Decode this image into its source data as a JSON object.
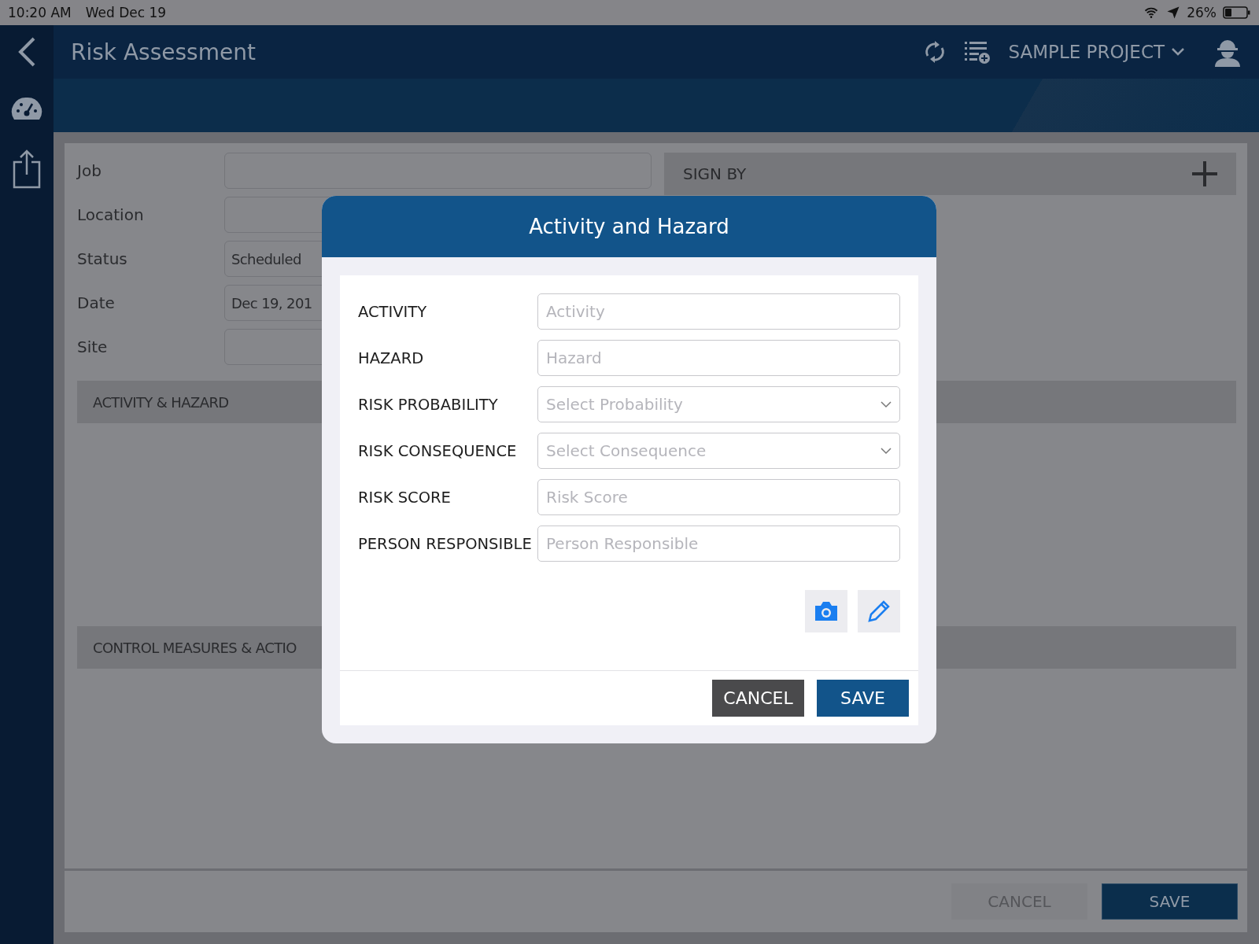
{
  "status_bar": {
    "time": "10:20 AM",
    "date": "Wed Dec 19",
    "battery": "26%"
  },
  "header": {
    "title": "Risk Assessment",
    "project": "SAMPLE PROJECT"
  },
  "form": {
    "fields": [
      {
        "label": "Job"
      },
      {
        "label": "Location"
      },
      {
        "label": "Status",
        "value": "Scheduled"
      },
      {
        "label": "Date",
        "value": "Dec 19, 201"
      },
      {
        "label": "Site"
      }
    ],
    "sign_by": "SIGN BY",
    "sections": [
      "ACTIVITY & HAZARD",
      "CONTROL MEASURES & ACTIO"
    ]
  },
  "footer": {
    "buttons": [
      {
        "label": "CANCEL",
        "kind": "secondary",
        "disabled": true
      },
      {
        "label": "SAVE",
        "kind": "primary",
        "disabled": false
      }
    ]
  },
  "modal": {
    "title": "Activity and Hazard",
    "fields": [
      {
        "label": "ACTIVITY",
        "placeholder": "Activity",
        "kind": "text"
      },
      {
        "label": "HAZARD",
        "placeholder": "Hazard",
        "kind": "text"
      },
      {
        "label": "RISK PROBABILITY",
        "placeholder": "Select Probability",
        "kind": "select"
      },
      {
        "label": "RISK CONSEQUENCE",
        "placeholder": "Select Consequence",
        "kind": "select"
      },
      {
        "label": "RISK SCORE",
        "placeholder": "Risk Score",
        "kind": "text"
      },
      {
        "label": "PERSON RESPONSIBLE",
        "placeholder": "Person Responsible",
        "kind": "text"
      }
    ],
    "buttons": [
      {
        "label": "CANCEL",
        "kind": "secondary"
      },
      {
        "label": "SAVE",
        "kind": "primary"
      }
    ]
  }
}
